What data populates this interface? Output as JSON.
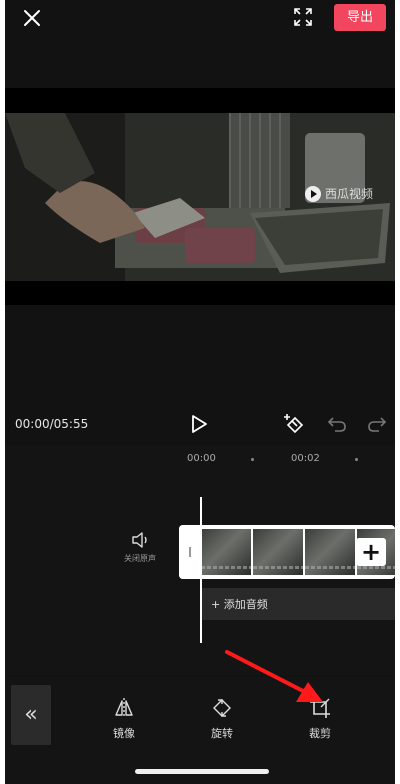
{
  "topbar": {
    "close_icon": "close-icon",
    "fullscreen_icon": "fullscreen-icon",
    "export_label": "导出"
  },
  "preview": {
    "watermark": "西瓜视频"
  },
  "playback": {
    "timecode": "00:00/05:55",
    "icons": [
      "play-icon",
      "keyframe-icon",
      "undo-icon",
      "redo-icon"
    ]
  },
  "timeline": {
    "ruler": [
      "00:00",
      "00:02"
    ],
    "mute_label": "关闭原声",
    "audio_label": "+ 添加音频"
  },
  "toolbar": {
    "back_label": "«",
    "tools": [
      {
        "label": "镜像",
        "icon": "mirror-icon"
      },
      {
        "label": "旋转",
        "icon": "rotate-icon"
      },
      {
        "label": "裁剪",
        "icon": "crop-icon"
      }
    ]
  },
  "annotation": {
    "arrow_color": "#ff1a1a"
  }
}
